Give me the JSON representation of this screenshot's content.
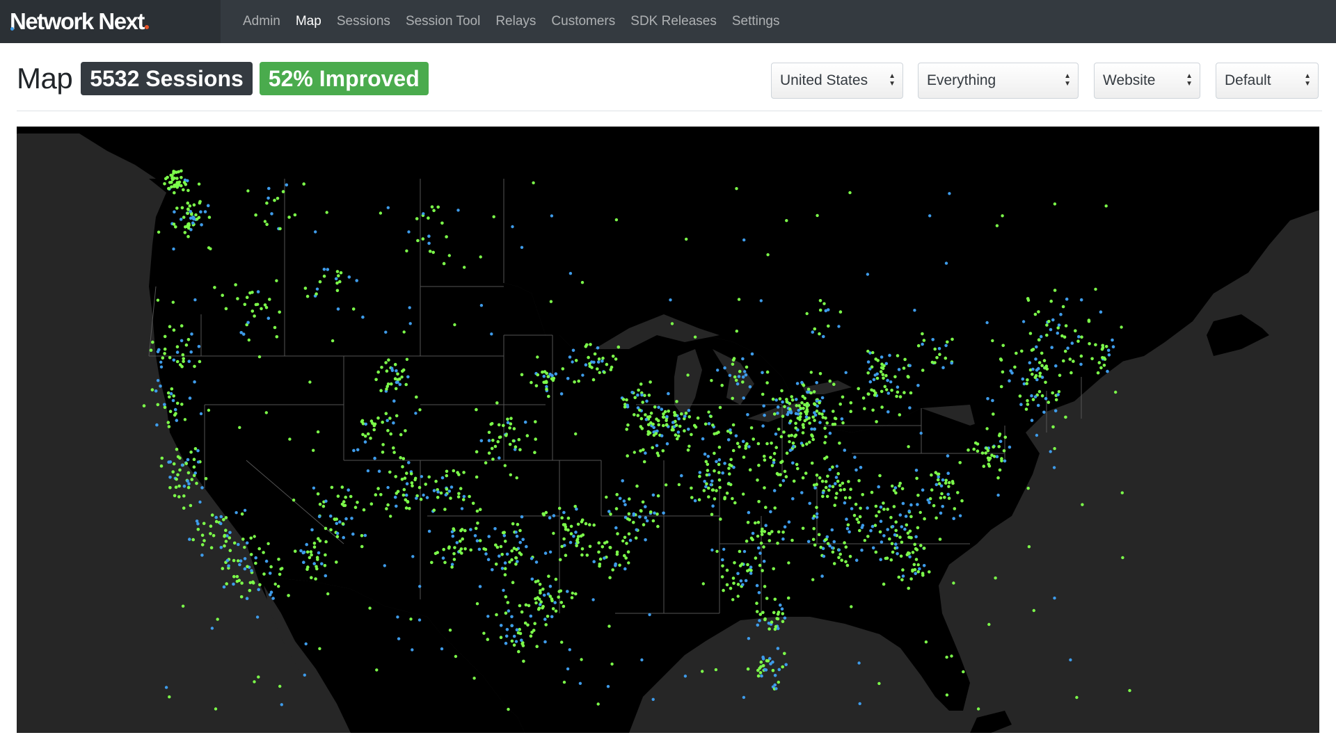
{
  "brand": {
    "name": "Network Next"
  },
  "nav": [
    {
      "label": "Admin",
      "active": false
    },
    {
      "label": "Map",
      "active": true
    },
    {
      "label": "Sessions",
      "active": false
    },
    {
      "label": "Session Tool",
      "active": false
    },
    {
      "label": "Relays",
      "active": false
    },
    {
      "label": "Customers",
      "active": false
    },
    {
      "label": "SDK Releases",
      "active": false
    },
    {
      "label": "Settings",
      "active": false
    }
  ],
  "page": {
    "title": "Map",
    "sessions_badge": "5532 Sessions",
    "improved_badge": "52% Improved"
  },
  "filters": {
    "region": "United States",
    "scope": "Everything",
    "source": "Website",
    "style": "Default"
  },
  "map": {
    "land_color": "#000000",
    "water_color": "#262626",
    "border_color": "#555555",
    "improved_color": "#7cfc4a",
    "normal_color": "#3e9be9"
  }
}
